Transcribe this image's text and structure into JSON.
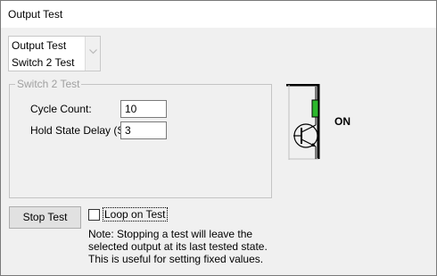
{
  "window": {
    "title": "Output Test"
  },
  "combo": {
    "lines": [
      "Output Test",
      "Switch 2 Test"
    ]
  },
  "group": {
    "title": "Switch 2 Test",
    "cycle_count_label": "Cycle Count:",
    "cycle_count_value": "10",
    "hold_delay_label": "Hold State Delay (S):",
    "hold_delay_value": "3"
  },
  "buttons": {
    "stop_test": "Stop Test"
  },
  "loop_checkbox": {
    "label": "Loop on Test",
    "checked": false
  },
  "note": {
    "line1": "Note: Stopping a test will leave the",
    "line2": "selected output at its last tested state.",
    "line3": "This is useful for setting fixed values."
  },
  "indicator": {
    "state": "ON",
    "led_color": "#2db82d"
  }
}
